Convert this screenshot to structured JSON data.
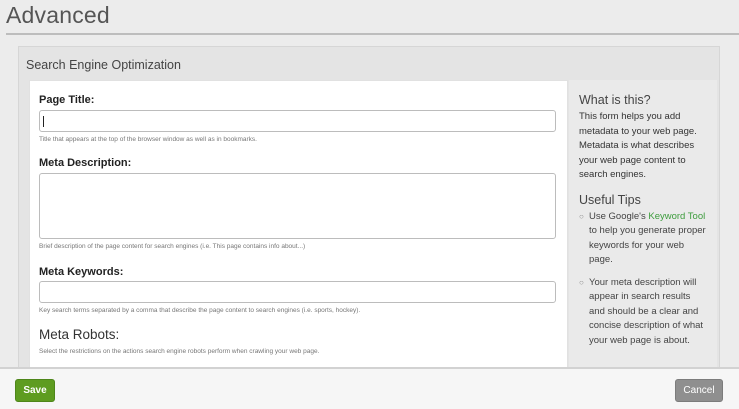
{
  "page": {
    "title": "Advanced"
  },
  "panel": {
    "header": "Search Engine Optimization"
  },
  "form": {
    "page_title": {
      "label": "Page Title:",
      "value": "",
      "hint": "Title that appears at the top of the browser window as well as in bookmarks."
    },
    "meta_description": {
      "label": "Meta Description:",
      "value": "",
      "hint": "Brief description of the page content for search engines (i.e. This page contains info about...)"
    },
    "meta_keywords": {
      "label": "Meta Keywords:",
      "value": "",
      "hint": "Key search terms separated by a comma that describe the page content to search engines (i.e. sports, hockey)."
    },
    "meta_robots": {
      "heading": "Meta Robots:",
      "hint": "Select the restrictions on the actions search engine robots perform when crawling your web page."
    }
  },
  "help": {
    "what_title": "What is this?",
    "what_body": "This form helps you add metadata to your web page. Metadata is what describes your web page content to search engines.",
    "tips_title": "Useful Tips",
    "tip1_before": "Use Google's ",
    "tip1_link": "Keyword Tool",
    "tip1_after": " to help you generate proper keywords for your web page.",
    "tip2": "Your meta description will appear in search results and should be a clear and concise description of what your web page is about."
  },
  "footer": {
    "save_label": "Save",
    "cancel_label": "Cancel"
  },
  "colors": {
    "save": "#5e9c20",
    "cancel": "#8f8f8f",
    "link": "#3c9c3c"
  }
}
